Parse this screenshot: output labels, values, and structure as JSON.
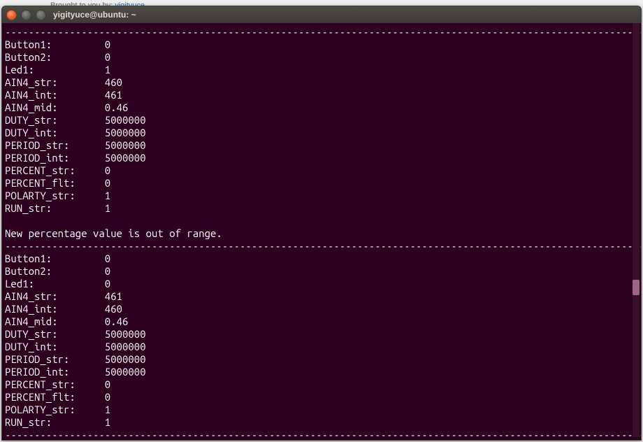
{
  "background": {
    "hint_prefix": "Brought to you by: ",
    "hint_link": "yigityuce"
  },
  "window": {
    "title": "yigityuce@ubuntu: ~"
  },
  "terminal": {
    "dash_line": "------------------------------------------------------------------------------------------------------------------",
    "message": "New percentage value is out of range.",
    "blocks": [
      {
        "rows": [
          {
            "label": "Button1:",
            "value": "0"
          },
          {
            "label": "Button2:",
            "value": "0"
          },
          {
            "label": "Led1:",
            "value": "1"
          },
          {
            "label": "AIN4_str:",
            "value": "460"
          },
          {
            "label": "AIN4_int:",
            "value": "461"
          },
          {
            "label": "AIN4_mid:",
            "value": "0.46"
          },
          {
            "label": "DUTY_str:",
            "value": "5000000"
          },
          {
            "label": "DUTY_int:",
            "value": "5000000"
          },
          {
            "label": "PERIOD_str:",
            "value": "5000000"
          },
          {
            "label": "PERIOD_int:",
            "value": "5000000"
          },
          {
            "label": "PERCENT_str:",
            "value": "0"
          },
          {
            "label": "PERCENT_flt:",
            "value": "0"
          },
          {
            "label": "POLARTY_str:",
            "value": "1"
          },
          {
            "label": "RUN_str:",
            "value": "1"
          }
        ]
      },
      {
        "rows": [
          {
            "label": "Button1:",
            "value": "0"
          },
          {
            "label": "Button2:",
            "value": "0"
          },
          {
            "label": "Led1:",
            "value": "0"
          },
          {
            "label": "AIN4_str:",
            "value": "461"
          },
          {
            "label": "AIN4_int:",
            "value": "460"
          },
          {
            "label": "AIN4_mid:",
            "value": "0.46"
          },
          {
            "label": "DUTY_str:",
            "value": "5000000"
          },
          {
            "label": "DUTY_int:",
            "value": "5000000"
          },
          {
            "label": "PERIOD_str:",
            "value": "5000000"
          },
          {
            "label": "PERIOD_int:",
            "value": "5000000"
          },
          {
            "label": "PERCENT_str:",
            "value": "0"
          },
          {
            "label": "PERCENT_flt:",
            "value": "0"
          },
          {
            "label": "POLARTY_str:",
            "value": "1"
          },
          {
            "label": "RUN_str:",
            "value": "1"
          }
        ]
      }
    ]
  }
}
